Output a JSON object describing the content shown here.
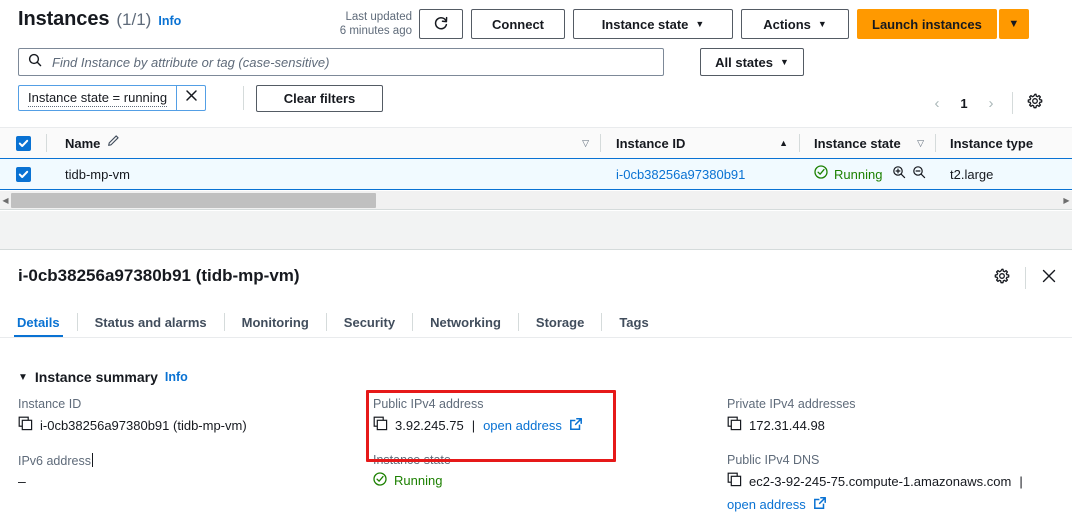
{
  "list": {
    "title": "Instances",
    "count": "(1/1)",
    "info": "Info",
    "last_updated_label": "Last updated",
    "last_updated_value": "6 minutes ago",
    "buttons": {
      "refresh": "refresh-icon",
      "connect": "Connect",
      "instance_state": "Instance state",
      "actions": "Actions",
      "launch": "Launch instances"
    },
    "search": {
      "placeholder": "Find Instance by attribute or tag (case-sensitive)",
      "value": ""
    },
    "states_filter": "All states",
    "filter_token": "Instance state = running",
    "clear_filters": "Clear filters",
    "pagination": {
      "prev": "‹",
      "page": "1",
      "next": "›"
    },
    "columns": [
      "Name",
      "Instance ID",
      "Instance state",
      "Instance type"
    ],
    "rows": [
      {
        "selected": true,
        "name": "tidb-mp-vm",
        "instance_id": "i-0cb38256a97380b91",
        "instance_state": "Running",
        "instance_type": "t2.large"
      }
    ]
  },
  "detail": {
    "title": "i-0cb38256a97380b91 (tidb-mp-vm)",
    "tabs": [
      {
        "label": "Details",
        "active": true
      },
      {
        "label": "Status and alarms",
        "active": false
      },
      {
        "label": "Monitoring",
        "active": false
      },
      {
        "label": "Security",
        "active": false
      },
      {
        "label": "Networking",
        "active": false
      },
      {
        "label": "Storage",
        "active": false
      },
      {
        "label": "Tags",
        "active": false
      }
    ],
    "summary": {
      "heading": "Instance summary",
      "info": "Info",
      "instance_id_label": "Instance ID",
      "instance_id_value": "i-0cb38256a97380b91 (tidb-mp-vm)",
      "ipv6_label": "IPv6 address",
      "ipv6_value": "–",
      "public_ipv4_label": "Public IPv4 address",
      "public_ipv4_value": "3.92.245.75",
      "public_ipv4_open": "open address",
      "instance_state_label": "Instance state",
      "instance_state_value": "Running",
      "private_ipv4_label": "Private IPv4 addresses",
      "private_ipv4_value": "172.31.44.98",
      "public_dns_label": "Public IPv4 DNS",
      "public_dns_value": "ec2-3-92-245-75.compute-1.amazonaws.com",
      "public_dns_open": "open address",
      "separator": "|"
    }
  },
  "colors": {
    "accent_blue": "#0972d3",
    "aws_orange": "#ff9900",
    "running_green": "#1d8102",
    "highlight_red": "#e61919"
  }
}
